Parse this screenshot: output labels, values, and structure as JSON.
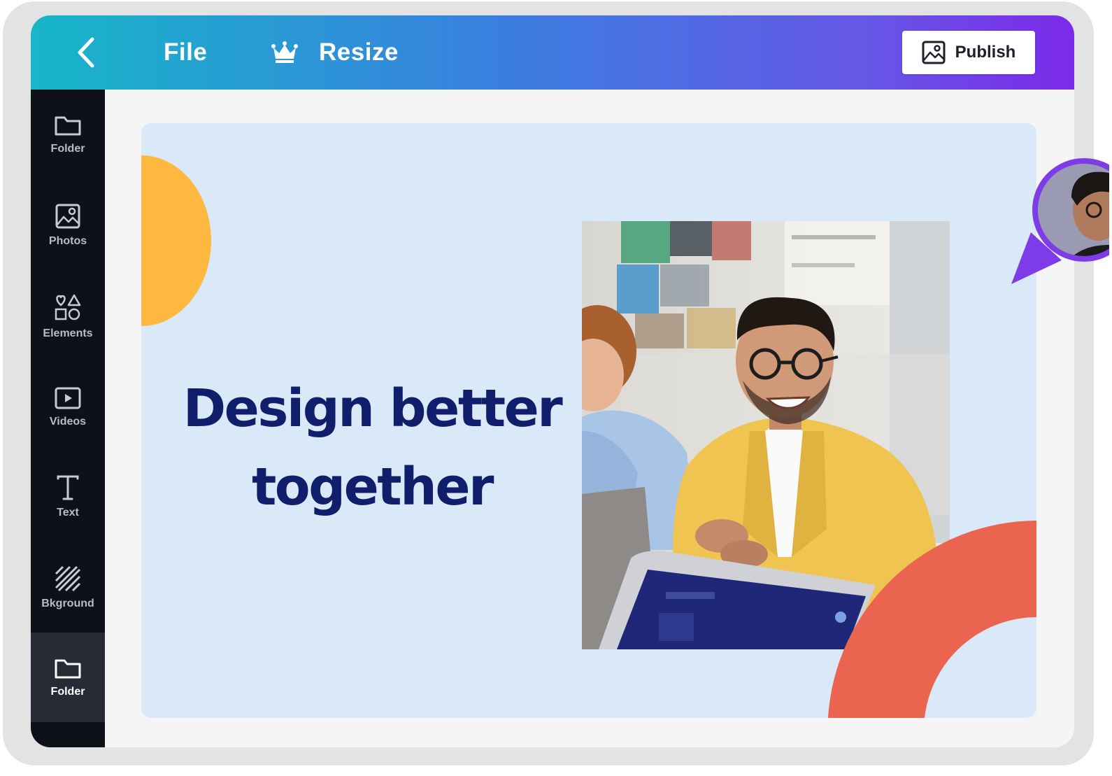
{
  "topbar": {
    "back_icon": "chevron-left-icon",
    "file_label": "File",
    "resize_icon": "crown-icon",
    "resize_label": "Resize",
    "publish_icon": "image-icon",
    "publish_label": "Publish",
    "gradient_start": "#17b6c8",
    "gradient_mid": "#3a7fe0",
    "gradient_end": "#7c2ae8"
  },
  "sidebar": {
    "items": [
      {
        "label": "Folder",
        "icon": "folder-icon"
      },
      {
        "label": "Photos",
        "icon": "photo-icon"
      },
      {
        "label": "Elements",
        "icon": "shapes-icon"
      },
      {
        "label": "Videos",
        "icon": "video-icon"
      },
      {
        "label": "Text",
        "icon": "text-icon"
      },
      {
        "label": "Bkground",
        "icon": "hatch-pattern-icon"
      },
      {
        "label": "Folder",
        "icon": "folder-icon",
        "active": true
      }
    ]
  },
  "canvas": {
    "headline_line1": "Design better",
    "headline_line2": "together",
    "background": "#d9e9f8",
    "headline_color": "#101e6b",
    "accent_yellow": "#fdb840",
    "accent_coral": "#ea6450"
  },
  "collaborator": {
    "ring_color": "#7d3ce8"
  }
}
